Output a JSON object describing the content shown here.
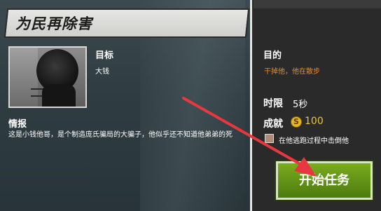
{
  "header": {
    "title": "为民再除害"
  },
  "target": {
    "label": "目标",
    "name": "大钱"
  },
  "intel": {
    "label": "情报",
    "description": "这是小钱他哥，是个制造庞氏骗局的大骗子，他似乎还不知道他弟弟的死"
  },
  "objective": {
    "label": "目的",
    "description": "干掉他，他在散步"
  },
  "time_limit": {
    "label": "时限",
    "value": "5秒"
  },
  "achievement": {
    "label": "成就",
    "coin_icon": "S",
    "reward": "100",
    "bonus_text": "在他逃跑过程中击倒他"
  },
  "start_button": {
    "label": "开始任务"
  },
  "icons": {
    "coin": "coin-icon",
    "arrow": "pointer-arrow-icon"
  },
  "colors": {
    "objective": "#f08a1c",
    "button": "#5d9214",
    "arrow": "#e8383f",
    "coin": "#e9b51c"
  }
}
